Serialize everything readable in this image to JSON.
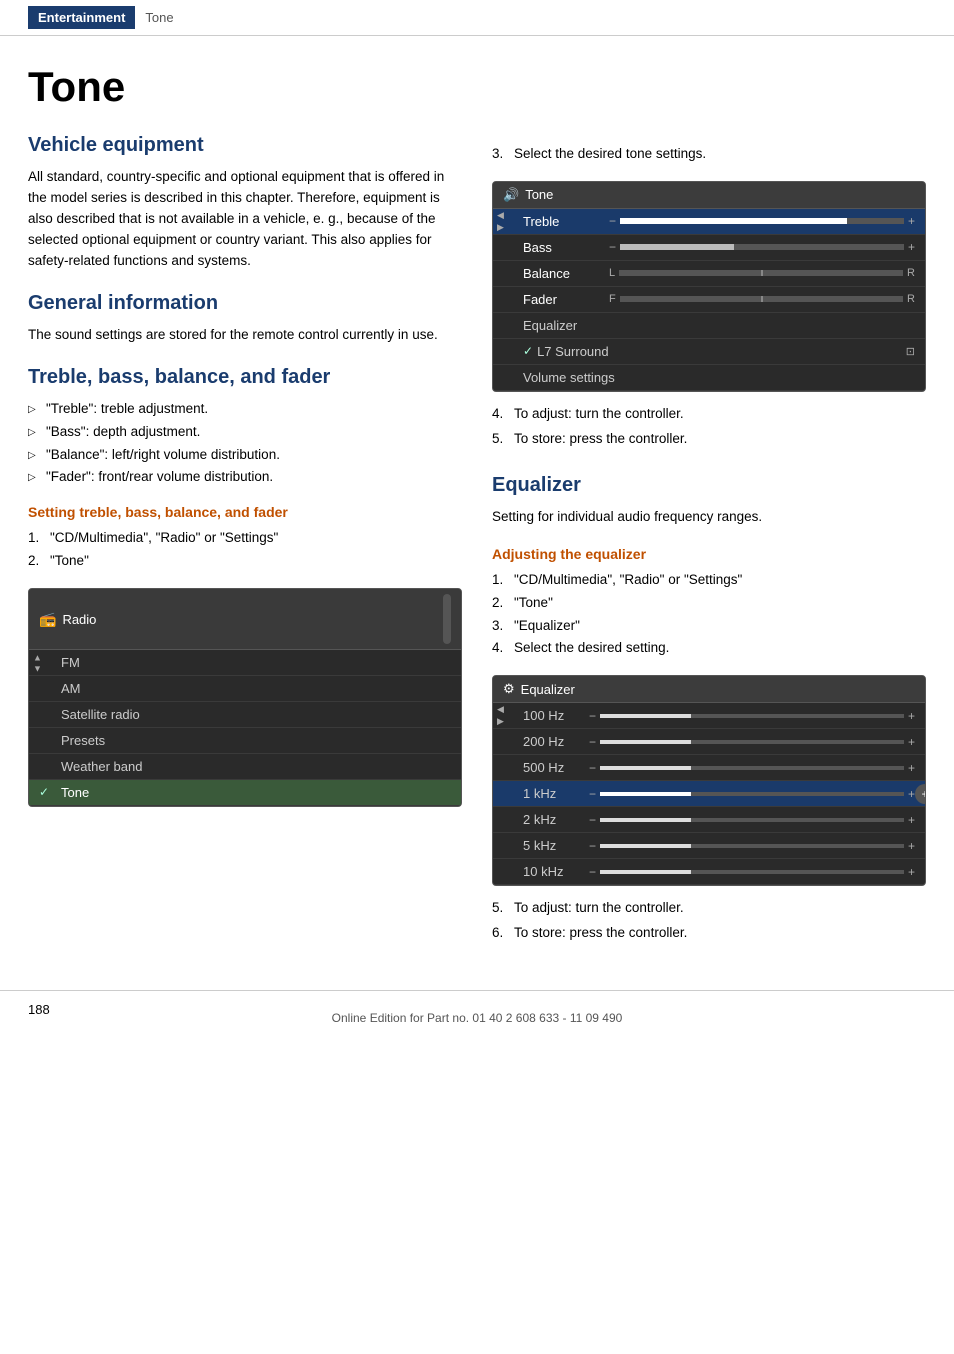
{
  "header": {
    "entertainment_label": "Entertainment",
    "tone_label": "Tone"
  },
  "page": {
    "title": "Tone",
    "page_number": "188",
    "footer_text": "Online Edition for Part no. 01 40 2 608 633 - 11 09 490"
  },
  "sections": {
    "vehicle_equipment": {
      "heading": "Vehicle equipment",
      "body": "All standard, country-specific and optional equipment that is offered in the model series is described in this chapter. Therefore, equipment is also described that is not available in a vehicle, e. g., because of the selected optional equipment or country variant. This also applies for safety-related functions and systems."
    },
    "general_information": {
      "heading": "General information",
      "body": "The sound settings are stored for the remote control currently in use."
    },
    "treble_bass": {
      "heading": "Treble, bass, balance, and fader",
      "bullets": [
        "\"Treble\": treble adjustment.",
        "\"Bass\": depth adjustment.",
        "\"Balance\": left/right volume distribution.",
        "\"Fader\": front/rear volume distribution."
      ],
      "subsection_heading": "Setting treble, bass, balance, and fader",
      "steps": [
        "\"CD/Multimedia\", \"Radio\" or \"Settings\"",
        "\"Tone\""
      ],
      "radio_mockup": {
        "title": "Radio",
        "items": [
          {
            "label": "FM",
            "selected": false
          },
          {
            "label": "AM",
            "selected": false
          },
          {
            "label": "Satellite radio",
            "selected": false
          },
          {
            "label": "Presets",
            "selected": false
          },
          {
            "label": "Weather band",
            "selected": false
          },
          {
            "label": "✓ Tone",
            "selected": true
          }
        ]
      }
    },
    "tone_steps_right": {
      "step3_label": "Select the desired tone settings.",
      "tone_mockup": {
        "title": "Tone",
        "rows": [
          {
            "label": "Treble",
            "type": "slider",
            "active": true,
            "fill": 80
          },
          {
            "label": "Bass",
            "type": "slider",
            "active": false,
            "fill": 40
          },
          {
            "label": "Balance",
            "type": "balance",
            "active": false
          },
          {
            "label": "Fader",
            "type": "fader",
            "active": false
          },
          {
            "label": "Equalizer",
            "type": "plain",
            "active": false
          },
          {
            "label": "✓ L7 Surround",
            "type": "plain-check",
            "active": false
          },
          {
            "label": "Volume settings",
            "type": "plain",
            "active": false
          }
        ]
      },
      "step4": "To adjust: turn the controller.",
      "step5": "To store: press the controller."
    },
    "equalizer": {
      "heading": "Equalizer",
      "body": "Setting for individual audio frequency ranges.",
      "subsection_heading": "Adjusting the equalizer",
      "steps": [
        "\"CD/Multimedia\", \"Radio\" or \"Settings\"",
        "\"Tone\"",
        "\"Equalizer\"",
        "Select the desired setting."
      ],
      "eq_mockup": {
        "title": "Equalizer",
        "rows": [
          {
            "label": "100 Hz",
            "active": false
          },
          {
            "label": "200 Hz",
            "active": false
          },
          {
            "label": "500 Hz",
            "active": false
          },
          {
            "label": "1 kHz",
            "active": true
          },
          {
            "label": "2 kHz",
            "active": false
          },
          {
            "label": "5 kHz",
            "active": false
          },
          {
            "label": "10 kHz",
            "active": false
          }
        ]
      },
      "step5": "To adjust: turn the controller.",
      "step6": "To store: press the controller."
    }
  }
}
